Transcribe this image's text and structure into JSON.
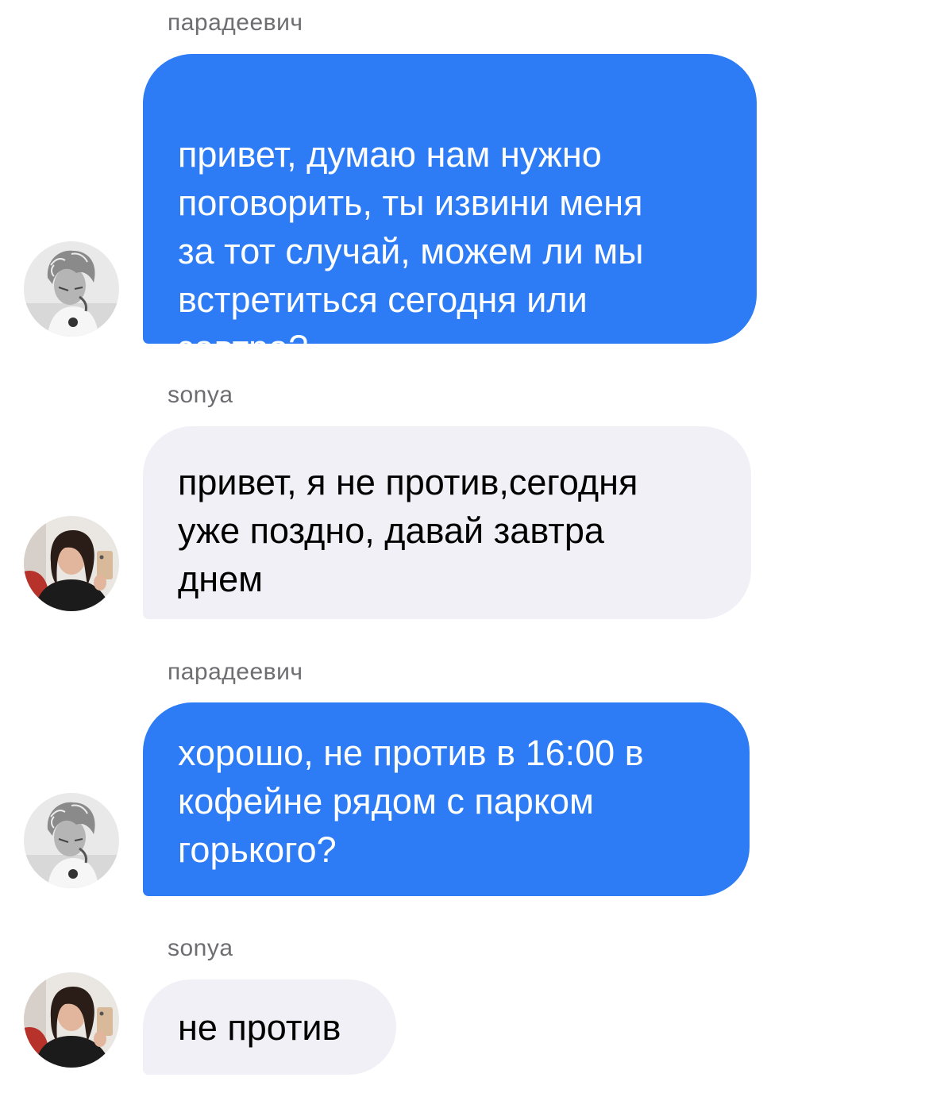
{
  "messages": [
    {
      "sender": "парадеевич",
      "direction": "outgoing",
      "lines": [
        "привет, думаю нам нужно",
        "поговорить, ты извини меня",
        "за тот случай, можем ли мы",
        "встретиться сегодня или",
        "завтра?"
      ]
    },
    {
      "sender": "sonya",
      "direction": "incoming",
      "lines": [
        "привет, я не против,сегодня",
        "уже поздно, давай завтра",
        "днем"
      ]
    },
    {
      "sender": "парадеевич",
      "direction": "outgoing",
      "lines": [
        "хорошо, не против в 16:00 в",
        "кофейне рядом с парком",
        "горького?"
      ]
    },
    {
      "sender": "sonya",
      "direction": "incoming",
      "lines": [
        "не против"
      ]
    }
  ],
  "colors": {
    "outgoing_bubble": "#2d7cf6",
    "incoming_bubble": "#f1f0f6",
    "sender_name": "#6d6d72"
  },
  "icons": {
    "avatar_outgoing": "user-avatar-bw-photo",
    "avatar_incoming": "user-avatar-color-photo"
  }
}
